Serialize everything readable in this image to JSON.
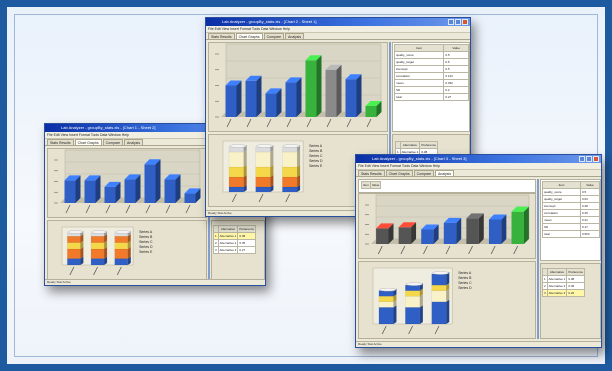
{
  "windows": [
    {
      "key": "left",
      "title": "Lab Analyzer - groupBy_stats.xls - [Chart 1 - Sheet 2]",
      "menu": "File  Edit  View  Insert  Format  Tools  Data  Window  Help",
      "tabs": [
        "Stats Results",
        "Chart Graphs",
        "Compare",
        "Analysis"
      ],
      "active_tab": 1,
      "status": "Ready  Stat Active",
      "chart_data": {
        "type": "bar",
        "values": [
          42,
          42,
          30,
          44,
          72,
          44,
          18
        ],
        "colors": [
          "#2f5fc4",
          "#2f5fc4",
          "#2f5fc4",
          "#2f5fc4",
          "#2f5fc4",
          "#2f5fc4",
          "#2f5fc4"
        ],
        "ylim": [
          0,
          80
        ]
      },
      "stack_data": {
        "type": "bar-stacked",
        "columns": [
          [
            {
              "c": "#2f5fc4",
              "v": 2
            },
            {
              "c": "#f07a2a",
              "v": 3
            },
            {
              "c": "#f5d84a",
              "v": 2
            },
            {
              "c": "#f07a2a",
              "v": 2
            },
            {
              "c": "#dcdcdc",
              "v": 1
            }
          ],
          [
            {
              "c": "#2f5fc4",
              "v": 2
            },
            {
              "c": "#f07a2a",
              "v": 3
            },
            {
              "c": "#f5d84a",
              "v": 2
            },
            {
              "c": "#f07a2a",
              "v": 2
            },
            {
              "c": "#dcdcdc",
              "v": 1
            }
          ],
          [
            {
              "c": "#2f5fc4",
              "v": 2
            },
            {
              "c": "#f07a2a",
              "v": 3
            },
            {
              "c": "#f5d84a",
              "v": 2
            },
            {
              "c": "#f07a2a",
              "v": 2
            },
            {
              "c": "#dcdcdc",
              "v": 1
            }
          ]
        ]
      },
      "legend": [
        "Series A",
        "Series B",
        "Series C",
        "Series D",
        "Series E"
      ],
      "table": {
        "headers": [
          "",
          "Alternative",
          "Preference"
        ],
        "rows": [
          [
            "1",
            "Alternative 1",
            "0.38"
          ],
          [
            "2",
            "Alternative 2",
            "0.35"
          ],
          [
            "3",
            "Alternative 3",
            "0.27"
          ]
        ],
        "highlight_row": 0
      }
    },
    {
      "key": "middle",
      "title": "Lab Analyzer - groupBy_stats.xls - [Chart 2 - Sheet 1]",
      "menu": "File  Edit  View  Insert  Format  Tools  Data  Window  Help",
      "tabs": [
        "Stats Results",
        "Chart Graphs",
        "Compare",
        "Analysis"
      ],
      "active_tab": 1,
      "status": "Ready  Stat Active",
      "chart_data": {
        "type": "bar",
        "values": [
          40,
          46,
          30,
          44,
          72,
          60,
          48,
          14
        ],
        "colors": [
          "#2f5fc4",
          "#2f5fc4",
          "#2f5fc4",
          "#2f5fc4",
          "#37b23c",
          "#8a8a8a",
          "#2f5fc4",
          "#37b23c"
        ],
        "ylim": [
          0,
          80
        ]
      },
      "stack_data": {
        "type": "bar-stacked",
        "columns": [
          [
            {
              "c": "#2f5fc4",
              "v": 1
            },
            {
              "c": "#f07a2a",
              "v": 2
            },
            {
              "c": "#f5d84a",
              "v": 2
            },
            {
              "c": "#f9f2c8",
              "v": 3
            },
            {
              "c": "#dcdcdc",
              "v": 1
            }
          ],
          [
            {
              "c": "#2f5fc4",
              "v": 1
            },
            {
              "c": "#f07a2a",
              "v": 2
            },
            {
              "c": "#f5d84a",
              "v": 2
            },
            {
              "c": "#f9f2c8",
              "v": 3
            },
            {
              "c": "#dcdcdc",
              "v": 1
            }
          ],
          [
            {
              "c": "#2f5fc4",
              "v": 1
            },
            {
              "c": "#f07a2a",
              "v": 2
            },
            {
              "c": "#f5d84a",
              "v": 2
            },
            {
              "c": "#f9f2c8",
              "v": 3
            },
            {
              "c": "#dcdcdc",
              "v": 1
            }
          ]
        ]
      },
      "legend": [
        "Series A",
        "Series B",
        "Series C",
        "Series D",
        "Series E"
      ],
      "side_table": {
        "headers": [
          "Item",
          "Value"
        ],
        "rows": [
          [
            "quality_score",
            "0.5"
          ],
          [
            "quality_target",
            "0.5"
          ],
          [
            "intercept",
            "0.5"
          ],
          [
            "correlation",
            "0.143"
          ],
          [
            "mean",
            "0.332"
          ],
          [
            "SD",
            "0.2"
          ],
          [
            "total",
            "0.27"
          ]
        ]
      },
      "table": {
        "headers": [
          "",
          "Alternative",
          "Preference"
        ],
        "rows": [
          [
            "1",
            "Alternative 1",
            "0.38"
          ],
          [
            "2",
            "Alternative 2",
            "0.35"
          ],
          [
            "3",
            "Alternative 3",
            "0.27"
          ]
        ],
        "highlight_row": 1
      }
    },
    {
      "key": "right",
      "title": "Lab Analyzer - groupBy_stats.xls - [Chart 3 - Sheet 3]",
      "menu": "File  Edit  View  Insert  Format  Tools  Data  Window  Help",
      "tabs": [
        "Stats Results",
        "Chart Graphs",
        "Compare",
        "Analysis"
      ],
      "active_tab": 3,
      "status": "Ready  Stat Active",
      "chart_data": {
        "type": "bar",
        "values": [
          28,
          30,
          26,
          38,
          46,
          44,
          58
        ],
        "colors": [
          "#555555",
          "#555555",
          "#2f5fc4",
          "#2f5fc4",
          "#555555",
          "#2f5fc4",
          "#37b23c"
        ],
        "tops": [
          "#c0392b",
          "#c0392b",
          "#2f5fc4",
          "#2f5fc4",
          "#555555",
          "#2f5fc4",
          "#37b23c"
        ],
        "ylim": [
          0,
          70
        ]
      },
      "stack_data": {
        "type": "bar-stacked",
        "columns": [
          [
            {
              "c": "#2f5fc4",
              "v": 3
            },
            {
              "c": "#f9f2c8",
              "v": 1
            },
            {
              "c": "#f5d84a",
              "v": 1
            },
            {
              "c": "#2f5fc4",
              "v": 1
            }
          ],
          [
            {
              "c": "#2f5fc4",
              "v": 3
            },
            {
              "c": "#f9f2c8",
              "v": 2
            },
            {
              "c": "#f5d84a",
              "v": 1
            },
            {
              "c": "#2f5fc4",
              "v": 1
            }
          ],
          [
            {
              "c": "#2f5fc4",
              "v": 4
            },
            {
              "c": "#f9f2c8",
              "v": 2
            },
            {
              "c": "#f5d84a",
              "v": 1
            },
            {
              "c": "#2f5fc4",
              "v": 2
            }
          ]
        ]
      },
      "legend": [
        "Series A",
        "Series B",
        "Series C",
        "Series D"
      ],
      "side_table": {
        "headers": [
          "Item",
          "Value"
        ],
        "rows": [
          [
            "quality_score",
            "0.5"
          ],
          [
            "quality_target",
            "0.63"
          ],
          [
            "intercept",
            "0.28"
          ],
          [
            "correlation",
            "0.45"
          ],
          [
            "mean",
            "0.21"
          ],
          [
            "SD",
            "0.17"
          ],
          [
            "total",
            "0.563"
          ]
        ]
      },
      "table": {
        "headers": [
          "",
          "Alternative",
          "Preference"
        ],
        "rows": [
          [
            "1",
            "Alternative 1",
            "0.38"
          ],
          [
            "2",
            "Alternative 2",
            "0.36"
          ],
          [
            "3",
            "Alternative 3",
            "0.26"
          ]
        ],
        "highlight_row": 2
      }
    }
  ]
}
